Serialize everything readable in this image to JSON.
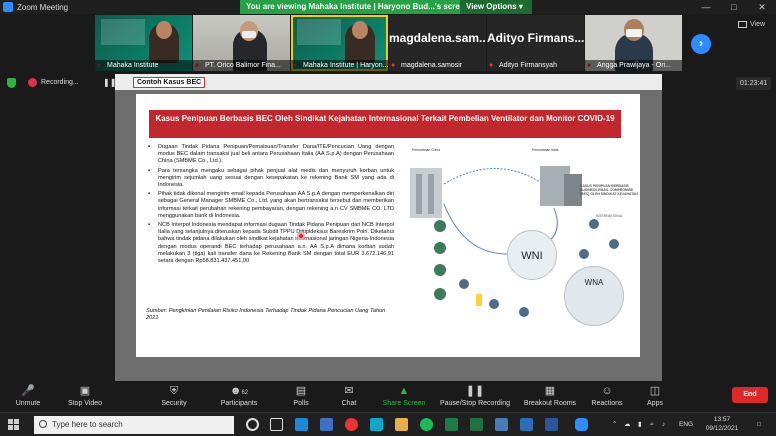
{
  "window": {
    "title": "Zoom Meeting",
    "sharing_banner": "You are viewing Mahaka Institute | Haryono Bud...'s screen",
    "view_options_label": "View Options ▾",
    "view_label": "View"
  },
  "participants": [
    {
      "name": "Mahaka Institute"
    },
    {
      "name": "PT. Orico Balimor Fina..."
    },
    {
      "name": "Mahaka Institute | Haryon..."
    },
    {
      "display": "magdalena.sam...",
      "name": "magdalena.samosir"
    },
    {
      "display": "Adityo Firmans...",
      "name": "Adityo Firmansyah"
    },
    {
      "name": "Angga Prawijaya - Ori..."
    }
  ],
  "recording": {
    "label": "Recording...",
    "pause": "❚❚",
    "stop": "■",
    "timer": "01:23:41"
  },
  "slide": {
    "header_label": "Contoh Kasus BEC",
    "title": "Kasus Penipuan Berbasis BEC Oleh Sindikat Kejahatan Internasional Terkait Pembelian Ventilator dan Monitor COVID-19",
    "bullets": [
      "Dugaan Tindak Pidana Penipuan/Pemalsuan/Transfer Dana/ITE/Pencucian Uang dengan modus BEC dalam transaksi jual beli antara Perusahaan Italia (AA S.p.A) dengan Perusahaan China (SMBME Co., Ltd.).",
      "Para tersangka mengaku sebagai pihak penjual alat medis dan menyuruh korban untuk mengirim sejumlah uang sesuai dengan kesepakatan ke rekening Bank SM yang ada di Indonesia.",
      "Pihak tidak dikenal mengirim email kepada Perusahaan AA S.p.A dengan memperkenalkan diri sebagai General Manager SMBME Co., Ltd. yang akan bertransaksi tersebut dan memberikan informasi terkait perubahan rekening pembayaran, dengan rekening a.n CV SMBME CO. LTD menggunakan bank di Indonesia.",
      "NCB Interpol Indonesia mendapat informasi dugaan Tindak Pidana Penipuan dari NCB Interpol Italia yang selanjutnya diteruskan kepada Subdit TPPU Dittipideksus Bareskrim Polri. Diketahui bahwa tindak pidana dilakukan oleh sindikat kejahatan internasional jaringan Nigeria-Indonesia dengan modus operandi BEC terhadap perusahaan a.n. AA S.p.A dimana korban sudah melakukan 3 (tiga) kali transfer dana ke Rekening Bank SM dengan total EUR 3.672.146,91 setara dengan Rp58.831.437.451,00"
    ],
    "source": "Sumber: Pengkinian Penilaian Risiko Indonesia Terhadap Tindak Pidana Pencucian Uang Tahun 2021",
    "diagram": {
      "seller_label": "Perusahaan China",
      "buyer_label": "Perusahaan Italia",
      "wni": "WNI",
      "wna": "WNA",
      "international_label": "INTERNATIONAL",
      "side_caption": "KASUS PENIPUAN BERBASIS BUSINESS EMAIL COMPROMISE (BEC) OLEH SINDIKAT KEJAHATAN"
    }
  },
  "toolbar": {
    "items": [
      {
        "label": "Unmute",
        "icon": "microphone-muted-icon"
      },
      {
        "label": "Stop Video",
        "icon": "video-camera-icon"
      },
      {
        "label": "Security",
        "icon": "shield-icon"
      },
      {
        "label": "Participants",
        "icon": "participants-icon",
        "count": "62"
      },
      {
        "label": "Polls",
        "icon": "polls-icon"
      },
      {
        "label": "Chat",
        "icon": "chat-icon"
      },
      {
        "label": "Share Screen",
        "icon": "share-screen-icon"
      },
      {
        "label": "Pause/Stop Recording",
        "icon": "pause-recording-icon"
      },
      {
        "label": "Breakout Rooms",
        "icon": "breakout-rooms-icon"
      },
      {
        "label": "Reactions",
        "icon": "reactions-icon"
      },
      {
        "label": "Apps",
        "icon": "apps-icon"
      }
    ],
    "end_label": "End"
  },
  "taskbar": {
    "search_placeholder": "Type here to search",
    "language": "ENG",
    "time": "13:57",
    "date": "09/12/2021"
  },
  "colors": {
    "zoom_blue": "#2d8cff",
    "banner_green": "#26a146",
    "end_red": "#e02828",
    "slide_title_red": "#c2272d"
  }
}
